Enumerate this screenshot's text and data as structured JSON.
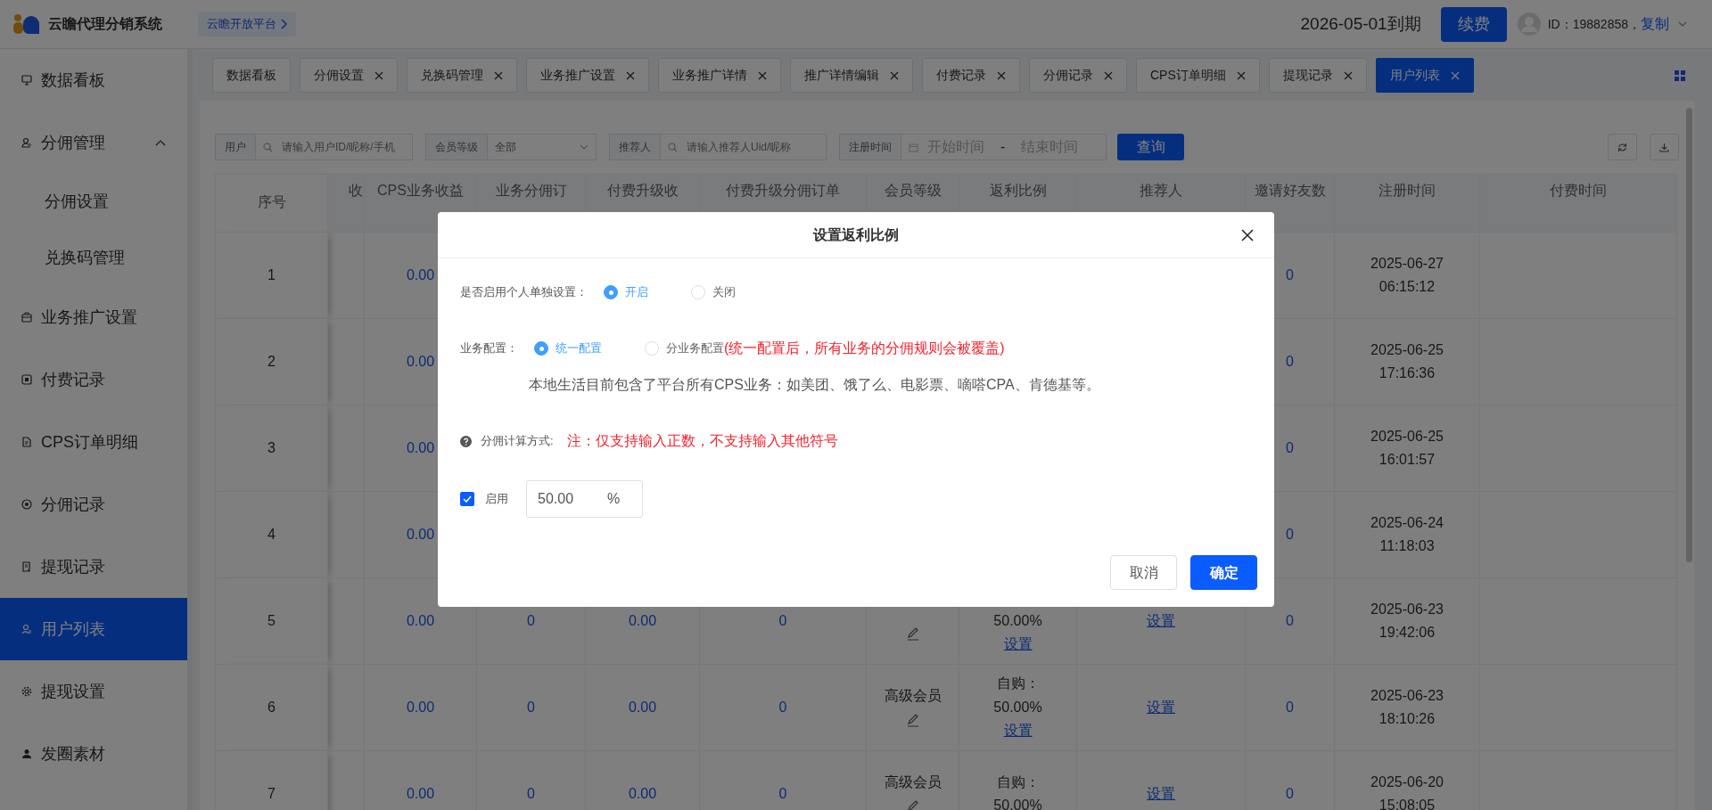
{
  "header": {
    "brand": "云瞻代理分销系统",
    "platform_link": "云瞻开放平台",
    "expiry": "2026-05-01到期",
    "renew_button": "续费",
    "user_id": "ID：19882858，",
    "copy_link": "复制"
  },
  "sidebar": [
    {
      "label": "数据看板",
      "selected": false
    },
    {
      "label": "分佣管理",
      "selected": false,
      "expanded": true,
      "children": [
        {
          "label": "分佣设置",
          "selected": false
        },
        {
          "label": "兑换码管理",
          "selected": false
        }
      ]
    },
    {
      "label": "业务推广设置",
      "selected": false
    },
    {
      "label": "付费记录",
      "selected": false
    },
    {
      "label": "CPS订单明细",
      "selected": false
    },
    {
      "label": "分佣记录",
      "selected": false
    },
    {
      "label": "提现记录",
      "selected": false
    },
    {
      "label": "用户列表",
      "selected": true
    },
    {
      "label": "提现设置",
      "selected": false
    },
    {
      "label": "发圈素材",
      "selected": false
    }
  ],
  "tabs": [
    {
      "label": "数据看板",
      "closable": false,
      "selected": false
    },
    {
      "label": "分佣设置",
      "closable": true,
      "selected": false
    },
    {
      "label": "兑换码管理",
      "closable": true,
      "selected": false
    },
    {
      "label": "业务推广设置",
      "closable": true,
      "selected": false
    },
    {
      "label": "业务推广详情",
      "closable": true,
      "selected": false
    },
    {
      "label": "推广详情编辑",
      "closable": true,
      "selected": false
    },
    {
      "label": "付费记录",
      "closable": true,
      "selected": false
    },
    {
      "label": "分佣记录",
      "closable": true,
      "selected": false
    },
    {
      "label": "CPS订单明细",
      "closable": true,
      "selected": false
    },
    {
      "label": "提现记录",
      "closable": true,
      "selected": false
    },
    {
      "label": "用户列表",
      "closable": true,
      "selected": true
    }
  ],
  "filters": [
    {
      "kind": "text",
      "label": "用户",
      "placeholder": "请输入用户ID/昵称/手机"
    },
    {
      "kind": "select",
      "label": "会员等级",
      "value": "全部"
    },
    {
      "kind": "text",
      "label": "推荐人",
      "placeholder": "请输入推荐人Uid/昵称"
    },
    {
      "kind": "daterange",
      "label": "注册时间",
      "start_placeholder": "开始时间",
      "separator": "-",
      "end_placeholder": "结束时间"
    }
  ],
  "search_button": "查询",
  "table": {
    "columns": [
      "序号",
      "收",
      "CPS业务收益",
      "业务分佣订",
      "付费升级收",
      "付费升级分佣订单",
      "会员等级",
      "返利比例",
      "推荐人",
      "邀请好友数",
      "注册时间",
      "付费时间"
    ],
    "rows": [
      {
        "index": "1",
        "cps_income": "0.00",
        "invites": "0",
        "reg_time": "2025-06-27 06:15:12"
      },
      {
        "index": "2",
        "cps_income": "0.00",
        "invites": "0",
        "reg_time": "2025-06-25 17:16:36"
      },
      {
        "index": "3",
        "cps_income": "0.00",
        "invites": "0",
        "reg_time": "2025-06-25 16:01:57"
      },
      {
        "index": "4",
        "cps_income": "0.00",
        "invites": "0",
        "reg_time": "2025-06-24 11:18:03"
      },
      {
        "index": "5",
        "cps_income": "0.00",
        "biz_orders": "0",
        "upgrade_income": "0.00",
        "upgrade_orders": "0",
        "rebate": "50.00%",
        "rebate_link": "设置",
        "referrer_link": "设置",
        "invites": "0",
        "reg_time": "2025-06-23 19:42:06"
      },
      {
        "index": "6",
        "cps_income": "0.00",
        "biz_orders": "0",
        "upgrade_income": "0.00",
        "upgrade_orders": "0",
        "member_level": "高级会员",
        "rebate_prefix": "自购：",
        "rebate": "50.00%",
        "rebate_link": "设置",
        "referrer_link": "设置",
        "invites": "0",
        "reg_time": "2025-06-23 18:10:26"
      },
      {
        "index": "7",
        "cps_income": "0.00",
        "biz_orders": "0",
        "upgrade_income": "0.00",
        "upgrade_orders": "0",
        "member_level": "高级会员",
        "rebate_prefix": "自购：",
        "rebate": "50.00%",
        "referrer_link": "设置",
        "invites": "0",
        "reg_time": "2025-06-20 15:08:05"
      }
    ]
  },
  "modal": {
    "title": "设置返利比例",
    "fields": [
      {
        "kind": "radio",
        "label": "是否启用个人单独设置：",
        "options": [
          {
            "label": "开启",
            "selected": true
          },
          {
            "label": "关闭",
            "selected": false
          }
        ]
      },
      {
        "kind": "radio",
        "label": "业务配置：",
        "options": [
          {
            "label": "统一配置",
            "selected": true
          },
          {
            "label": "分业务配置",
            "selected": false
          }
        ],
        "note": "(统一配置后，所有业务的分佣规则会被覆盖)",
        "description": "本地生活目前包含了平台所有CPS业务：如美团、饿了么、电影票、嘀嗒CPA、肯德基等。"
      },
      {
        "kind": "info",
        "label": "分佣计算方式:",
        "note": "注：仅支持输入正数，不支持输入其他符号"
      },
      {
        "kind": "rate",
        "label": "启用",
        "checked": true,
        "value": "50.00",
        "unit": "%"
      }
    ],
    "buttons": [
      {
        "label": "取消",
        "kind": "secondary"
      },
      {
        "label": "确定",
        "kind": "primary"
      }
    ]
  }
}
